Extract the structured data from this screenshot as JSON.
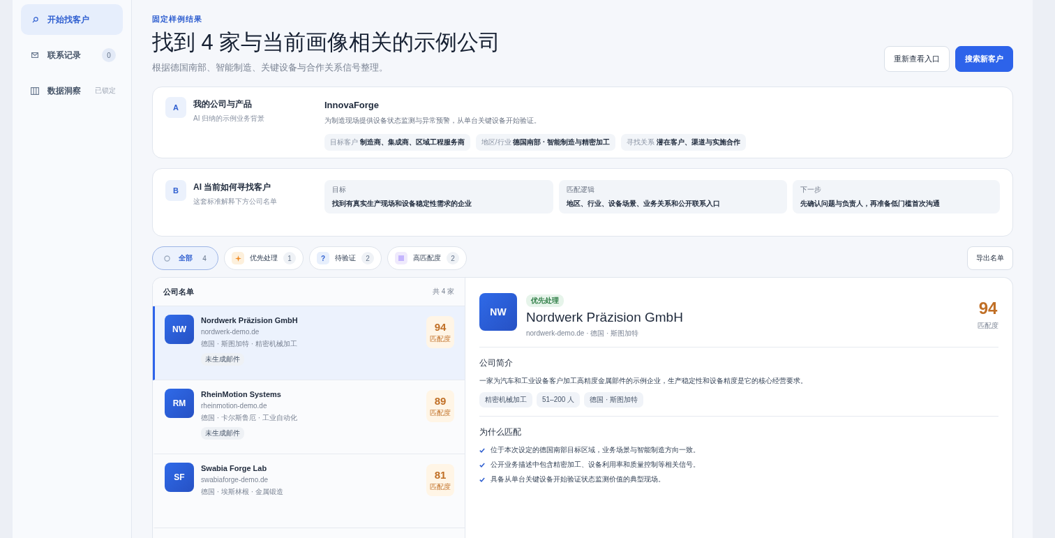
{
  "sidebar": {
    "items": [
      {
        "kind": "search",
        "label": "开始找客户",
        "selected": true
      },
      {
        "kind": "mail",
        "label": "联系记录",
        "selected": false,
        "badge": "0"
      },
      {
        "kind": "chart",
        "label": "数据洞察",
        "selected": false,
        "note": "已锁定"
      }
    ]
  },
  "header": {
    "eyebrow": "固定样例结果",
    "title": "找到 4 家与当前画像相关的示例公司",
    "subtitle": "根据德国南部、智能制造、关键设备与合作关系信号整理。",
    "buttons": [
      {
        "label": "重新查看入口",
        "primary": false
      },
      {
        "label": "搜索新客户",
        "primary": true
      }
    ]
  },
  "card_a": {
    "letter": "A",
    "title": "我的公司与产品",
    "subtitle": "AI 归纳的示例业务背景",
    "product": "InnovaForge",
    "description": "为制造现场提供设备状态监测与异常预警，从单台关键设备开始验证。",
    "tags": [
      {
        "label": "目标客户",
        "value": "制造商、集成商、区域工程服务商"
      },
      {
        "label": "地区/行业",
        "value": "德国南部 · 智能制造与精密加工"
      },
      {
        "label": "寻找关系",
        "value": "潜在客户、渠道与实施合作"
      }
    ]
  },
  "card_b": {
    "letter": "B",
    "title": "AI 当前如何寻找客户",
    "subtitle": "这套标准解释下方公司名单",
    "boxes": [
      {
        "label": "目标",
        "value": "找到有真实生产现场和设备稳定性需求的企业"
      },
      {
        "label": "匹配逻辑",
        "value": "地区、行业、设备场景、业务关系和公开联系入口"
      },
      {
        "label": "下一步",
        "value": "先确认问题与负责人，再准备低门槛首次沟通"
      }
    ]
  },
  "filters": [
    {
      "kind": "all",
      "label": "全部",
      "count": "4",
      "selected": true
    },
    {
      "kind": "priority",
      "label": "优先处理",
      "count": "1",
      "selected": false
    },
    {
      "kind": "verify",
      "icon_text": "?",
      "label": "待验证",
      "count": "2",
      "selected": false
    },
    {
      "kind": "match",
      "label": "高匹配度",
      "count": "2",
      "selected": false
    }
  ],
  "export_button": "导出名单",
  "company_list": {
    "title": "公司名单",
    "total": "共 4 家",
    "items": [
      {
        "initials": "NW",
        "name": "Nordwerk Präzision GmbH",
        "domain": "nordwerk-demo.de",
        "location": "德国 · 斯图加特 · 精密机械加工",
        "tag": "未生成邮件",
        "score": "94",
        "score_label": "匹配度",
        "selected": true
      },
      {
        "initials": "RM",
        "name": "RheinMotion Systems",
        "domain": "rheinmotion-demo.de",
        "location": "德国 · 卡尔斯鲁厄 · 工业自动化",
        "tag": "未生成邮件",
        "score": "89",
        "score_label": "匹配度",
        "selected": false
      },
      {
        "initials": "SF",
        "name": "Swabia Forge Lab",
        "domain": "swabiaforge-demo.de",
        "location": "德国 · 埃斯林根 · 金属锻造",
        "score": "81",
        "score_label": "匹配度",
        "selected": false
      }
    ]
  },
  "detail": {
    "badge": "优先处理",
    "initials": "NW",
    "name": "Nordwerk Präzision GmbH",
    "meta": "nordwerk-demo.de · 德国 · 斯图加特",
    "score": "94",
    "score_label": "匹配度",
    "about_title": "公司简介",
    "about": "一家为汽车和工业设备客户加工高精度金属部件的示例企业，生产稳定性和设备精度是它的核心经营要求。",
    "tags": [
      "精密机械加工",
      "51–200 人",
      "德国 · 斯图加特"
    ],
    "why_title": "为什么匹配",
    "reasons": [
      "位于本次设定的德国南部目标区域，业务场景与智能制造方向一致。",
      "公开业务描述中包含精密加工、设备利用率和质量控制等相关信号。",
      "具备从单台关键设备开始验证状态监测价值的典型现场。"
    ]
  }
}
